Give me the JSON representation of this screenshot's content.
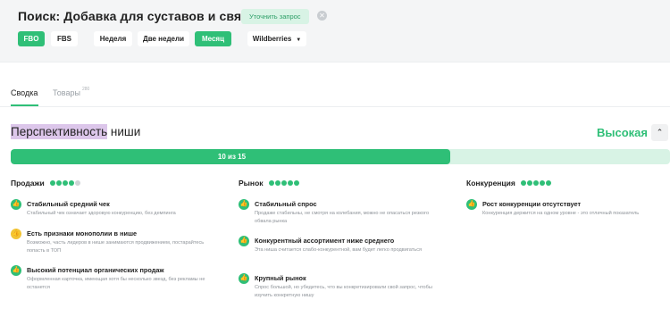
{
  "header": {
    "title": "Поиск: Добавка для суставов и связок",
    "refine_label": "Уточнить запрос",
    "filters": {
      "fbo": "FBO",
      "fbs": "FBS",
      "week": "Неделя",
      "two_weeks": "Две недели",
      "month": "Месяц",
      "marketplace": "Wildberries"
    }
  },
  "tabs": {
    "summary": "Сводка",
    "goods": "Товары",
    "goods_count": "280"
  },
  "niche": {
    "title_highlight": "Перспективность",
    "title_rest": " ниши",
    "rating": "Высокая",
    "score_label": "10 из 15",
    "score": 10,
    "score_max": 15
  },
  "columns": [
    {
      "title": "Продажи",
      "dots": 4,
      "dots_max": 5,
      "items": [
        {
          "status": "good",
          "title": "Стабильный средний чек",
          "desc": "Стабильный чек означает здоровую конкуренцию, без демпинга"
        },
        {
          "status": "warn",
          "title": "Есть признаки монополии в нише",
          "desc": "Возможно, часть лидеров в нише занимаются продвижением, постарайтесь попасть в ТОП"
        },
        {
          "status": "good",
          "title": "Высокий потенциал органических продаж",
          "desc": "Оформленная карточка, имеющая хотя бы несколько звезд, без рекламы не останется"
        }
      ]
    },
    {
      "title": "Рынок",
      "dots": 5,
      "dots_max": 5,
      "items": [
        {
          "status": "good",
          "title": "Стабильный спрос",
          "desc": "Продаже стабильны, не смотря на колебания, можно не опасаться резкого обвала рынка"
        },
        {
          "status": "good",
          "title": "Конкурентный ассортимент ниже среднего",
          "desc": "Эта ниша считается слабо-конкурентной, вам будет легко продвигаться"
        },
        {
          "status": "good",
          "title": "Крупный рынок",
          "desc": "Спрос большой, но убедитесь, что вы конкретизировали свой запрос, чтобы изучить конкретную нишу"
        }
      ]
    },
    {
      "title": "Конкуренция",
      "dots": 5,
      "dots_max": 5,
      "items": [
        {
          "status": "good",
          "title": "Рост конкуренции отсутствует",
          "desc": "Конкуренция держится на одном уровне - это отличный показатель"
        }
      ]
    }
  ],
  "colors": {
    "accent": "#2fbf77",
    "accent_light": "#d8f3e5",
    "warn": "#f2c434",
    "highlight": "#dcc6ea"
  },
  "icons": {
    "good": "thumb-up-icon",
    "warn": "thumb-up-warning-icon",
    "clear": "close-circle-icon",
    "collapse": "chevron-up-icon",
    "dropdown": "caret-down-icon"
  }
}
